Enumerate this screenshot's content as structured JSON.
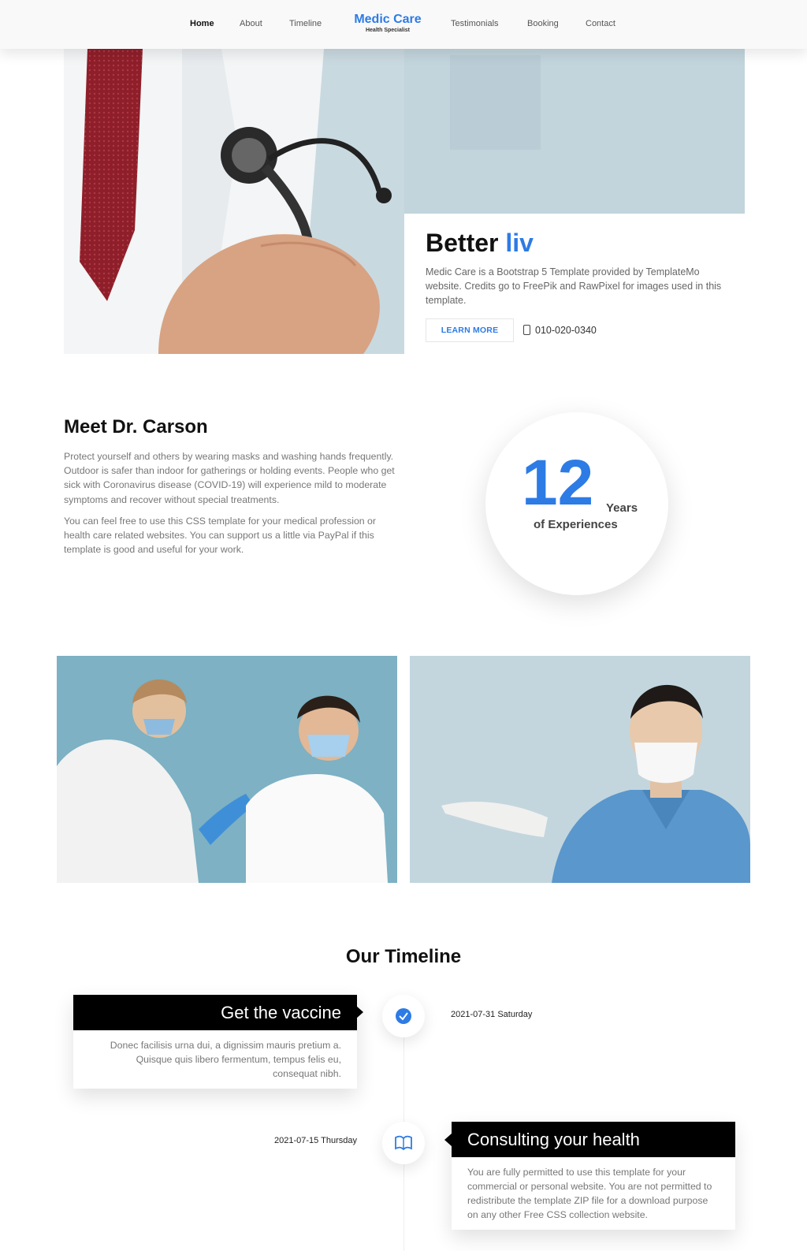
{
  "nav": {
    "brand": "Medic Care",
    "brand_sub": "Health Specialist",
    "items": [
      "Home",
      "About",
      "Timeline",
      "Testimonials",
      "Booking",
      "Contact"
    ]
  },
  "hero": {
    "title_static": "Better",
    "title_typed": "liv",
    "description": "Medic Care is a Bootstrap 5 Template provided by TemplateMo website. Credits go to FreePik and RawPixel for images used in this template.",
    "learn_more": "LEARN MORE",
    "phone": "010-020-0340"
  },
  "about": {
    "title": "Meet Dr. Carson",
    "p1": "Protect yourself and others by wearing masks and washing hands frequently. Outdoor is safer than indoor for gatherings or holding events. People who get sick with Coronavirus disease (COVID-19) will experience mild to moderate symptoms and recover without special treatments.",
    "p2": "You can feel free to use this CSS template for your medical profession or health care related websites. You can support us a little via PayPal if this template is good and useful for your work.",
    "years_number": "12",
    "years_label": "Years",
    "years_sub": "of Experiences"
  },
  "timeline": {
    "title": "Our Timeline",
    "items": [
      {
        "title": "Get the vaccine",
        "text": "Donec facilisis urna dui, a dignissim mauris pretium a. Quisque quis libero fermentum, tempus felis eu, consequat nibh.",
        "date": "2021-07-31 Saturday",
        "icon": "check-badge-icon"
      },
      {
        "title": "Consulting your health",
        "text": "You are fully permitted to use this template for your commercial or personal website. You are not permitted to redistribute the template ZIP file for a download purpose on any other Free CSS collection website.",
        "date": "2021-07-15 Thursday",
        "icon": "book-icon"
      }
    ]
  },
  "colors": {
    "accent": "#2d7be5",
    "dark": "#000000"
  }
}
